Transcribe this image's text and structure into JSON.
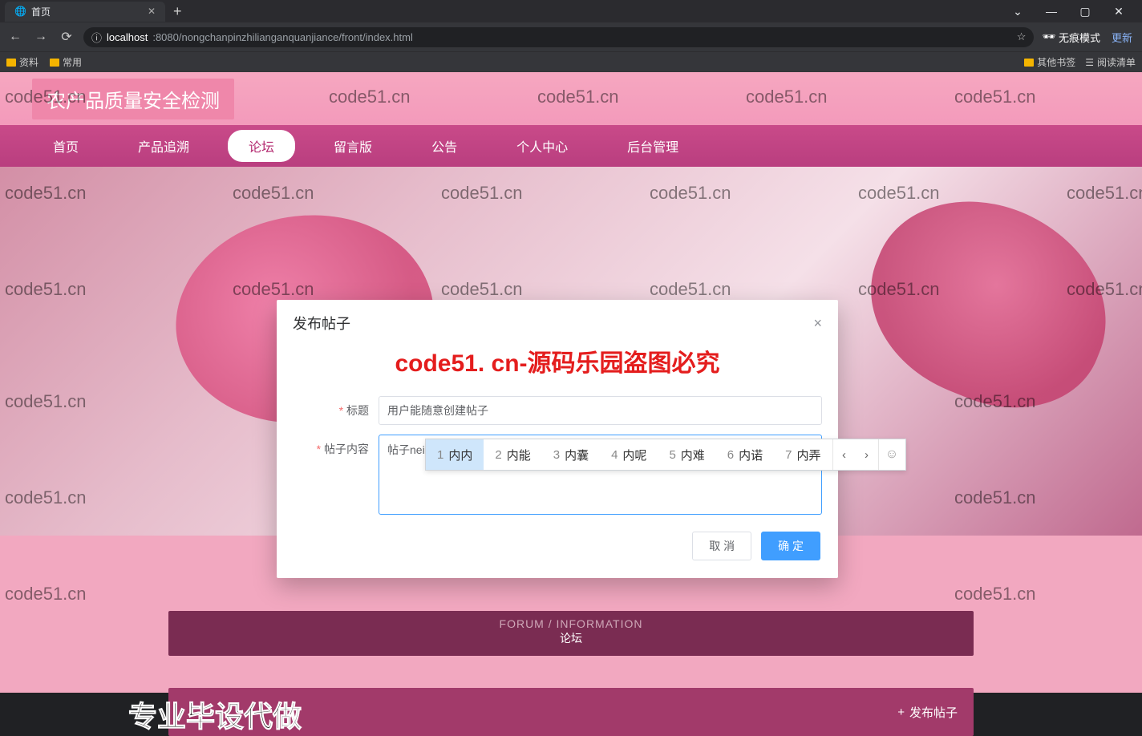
{
  "browser": {
    "tab_title": "首页",
    "url_info_icon": "ⓘ",
    "url_host": "localhost",
    "url_port_path": ":8080/nongchanpinzhilianganquanjiance/front/index.html",
    "incognito_label": "无痕模式",
    "update_label": "更新",
    "win": {
      "chevron": "⌄",
      "min": "—",
      "max": "▢",
      "close": "✕"
    },
    "bookmarks": {
      "b1": "资料",
      "b2": "常用",
      "other": "其他书签",
      "reading": "阅读清单"
    }
  },
  "site": {
    "title": "农产品质量安全检测",
    "nav": {
      "home": "首页",
      "trace": "产品追溯",
      "forum": "论坛",
      "guestbook": "留言版",
      "notice": "公告",
      "personal": "个人中心",
      "admin": "后台管理"
    }
  },
  "forum_section": {
    "en": "FORUM / INFORMATION",
    "zh": "论坛",
    "publish_btn": "发布帖子",
    "plus": "+"
  },
  "modal": {
    "title": "发布帖子",
    "watermark": "code51. cn-源码乐园盗图必究",
    "label_title": "标题",
    "value_title": "用户能随意创建帖子",
    "label_content": "帖子内容",
    "value_content": "帖子nei'n'r",
    "cancel": "取 消",
    "confirm": "确 定",
    "close": "×",
    "cursor_glyph": "I"
  },
  "ime": {
    "candidates": [
      {
        "n": "1",
        "text": "内内",
        "selected": true
      },
      {
        "n": "2",
        "text": "内能"
      },
      {
        "n": "3",
        "text": "内囊"
      },
      {
        "n": "4",
        "text": "内呢"
      },
      {
        "n": "5",
        "text": "内难"
      },
      {
        "n": "6",
        "text": "内诺"
      },
      {
        "n": "7",
        "text": "内弄"
      }
    ],
    "prev": "‹",
    "next": "›",
    "emoji": "☺"
  },
  "watermarks": {
    "tag": "code51.cn",
    "bottom_caption": "专业毕设代做"
  }
}
